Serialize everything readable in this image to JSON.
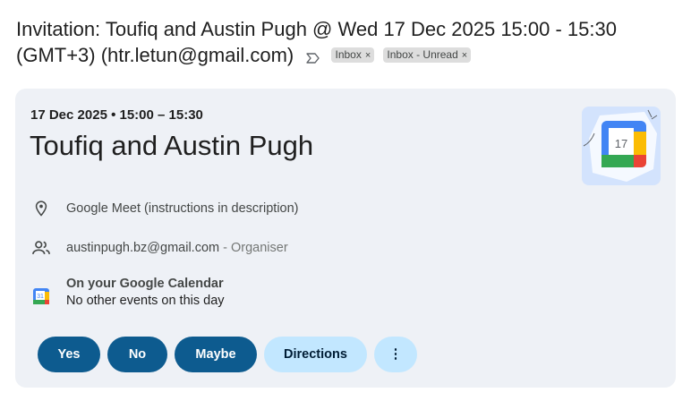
{
  "email": {
    "subject_line1": "Invitation: Toufiq and Austin Pugh @ Wed 17 Dec 2025 15:00 - 15:30",
    "subject_line2": "(GMT+3) (htr.letun@gmail.com)",
    "labels": [
      {
        "name": "Inbox",
        "remove": "×"
      },
      {
        "name": "Inbox - Unread",
        "remove": "×"
      }
    ]
  },
  "event": {
    "date_time": "17 Dec 2025 • 15:00 – 15:30",
    "title": "Toufiq and Austin Pugh",
    "logo_number": "17",
    "location": "Google Meet (instructions in description)",
    "organiser_email": "austinpugh.bz@gmail.com",
    "organiser_role": " - Organiser",
    "calendar_title": "On your Google Calendar",
    "calendar_sub": "No other events on this day",
    "calendar_icon_number": "31"
  },
  "actions": {
    "yes": "Yes",
    "no": "No",
    "maybe": "Maybe",
    "directions": "Directions",
    "more": "⋮"
  },
  "colors": {
    "card_bg": "#eef1f6",
    "primary_button": "#0d5b8f",
    "secondary_button": "#c2e7ff"
  }
}
